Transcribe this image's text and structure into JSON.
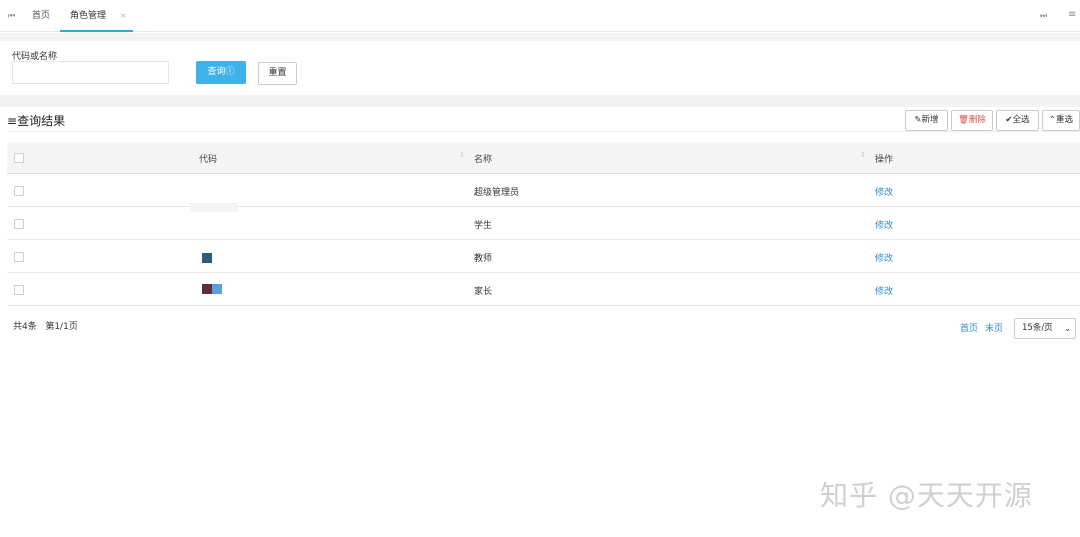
{
  "tabs": {
    "first_icon": "⏮",
    "home": "首页",
    "active": "角色管理",
    "close": "×",
    "last_icon": "⏭",
    "menu_icon": "≡"
  },
  "search": {
    "label": "代码或名称",
    "input_value": "",
    "query_label": "查询",
    "query_icon": "ⓘ",
    "reset_label": "重置"
  },
  "result": {
    "title_icon": "≡",
    "title": "查询结果",
    "toolbar": [
      {
        "icon": "✎",
        "label": "新增"
      },
      {
        "icon": "🗑",
        "label": "删除"
      },
      {
        "icon": "✔",
        "label": "全选"
      },
      {
        "icon": "⌃",
        "label": "重选"
      }
    ]
  },
  "table": {
    "headers": [
      "代码",
      "名称",
      "操作"
    ],
    "sort_glyph": "⇕",
    "rows": [
      {
        "code": "",
        "name": "超级管理员",
        "action": "修改"
      },
      {
        "code": "",
        "name": "学生",
        "action": "修改"
      },
      {
        "code": "",
        "name": "教师",
        "action": "修改"
      },
      {
        "code": "",
        "name": "家长",
        "action": "修改"
      }
    ]
  },
  "footer": {
    "total": "共4条",
    "page_info": "第1/1页",
    "first": "首页",
    "last": "末页",
    "page_size": "15条/页"
  },
  "watermark": "知乎 @天天开源",
  "colors": {
    "accent": "#3fb2ea",
    "link": "#2f8bcc",
    "danger": "#d9534f"
  }
}
